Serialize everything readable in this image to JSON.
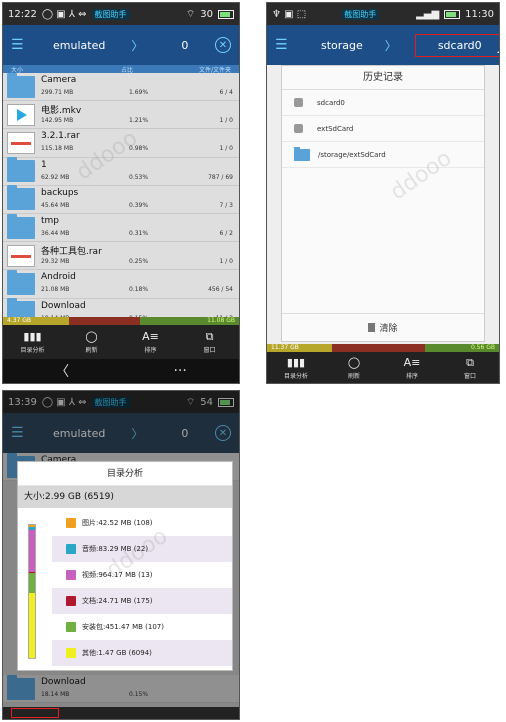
{
  "shot1": {
    "status": {
      "time": "12:22",
      "center": "截图助手",
      "battery": "30"
    },
    "appbar": {
      "path": "emulated",
      "sep": "〉",
      "count": "0"
    },
    "columns": [
      "大小",
      "占比",
      "文件/文件夹"
    ],
    "files": [
      {
        "name": "Camera",
        "size": "299.71 MB",
        "pct": "1.69%",
        "count": "6 / 4",
        "type": "folder"
      },
      {
        "name": "电影.mkv",
        "size": "142.95 MB",
        "pct": "1.21%",
        "count": "1 / 0",
        "type": "video"
      },
      {
        "name": "3.2.1.rar",
        "size": "115.18 MB",
        "pct": "0.98%",
        "count": "1 / 0",
        "type": "archive"
      },
      {
        "name": "1",
        "size": "62.92 MB",
        "pct": "0.53%",
        "count": "787 / 69",
        "type": "folder"
      },
      {
        "name": "backups",
        "size": "45.64 MB",
        "pct": "0.39%",
        "count": "7 / 3",
        "type": "folder"
      },
      {
        "name": "tmp",
        "size": "36.44 MB",
        "pct": "0.31%",
        "count": "6 / 2",
        "type": "folder"
      },
      {
        "name": "各种工具包.rar",
        "size": "29.32 MB",
        "pct": "0.25%",
        "count": "1 / 0",
        "type": "archive"
      },
      {
        "name": "Android",
        "size": "21.08 MB",
        "pct": "0.18%",
        "count": "456 / 54",
        "type": "folder"
      },
      {
        "name": "Download",
        "size": "18.14 MB",
        "pct": "0.15%",
        "count": "11 / 3",
        "type": "folder"
      }
    ],
    "storage": {
      "used": "4.37 GB",
      "mid": "",
      "free": "11.08 GB"
    },
    "bottom": [
      {
        "icon": "▮▮▮",
        "label": "目录分析"
      },
      {
        "icon": "◯",
        "label": "刷新"
      },
      {
        "icon": "A≡",
        "label": "排序"
      },
      {
        "icon": "⧉",
        "label": "窗口"
      }
    ],
    "nav": {
      "back": "〈",
      "more": "···"
    }
  },
  "shot2": {
    "status": {
      "time": "11:30",
      "center": "截图助手"
    },
    "appbar": {
      "path": "storage",
      "sep": "〉",
      "current": "sdcard0"
    },
    "dialog_title": "历史记录",
    "history": [
      {
        "label": "sdcard0",
        "type": "drive"
      },
      {
        "label": "extSdCard",
        "type": "drive"
      },
      {
        "label": "/storage/extSdCard",
        "type": "folder"
      }
    ],
    "clear_label": "清除",
    "storage": {
      "used": "11.37 GB",
      "mid": "",
      "free": "0.56 GB"
    },
    "bottom": [
      {
        "icon": "▮▮▮",
        "label": "目录分析"
      },
      {
        "icon": "◯",
        "label": "刷新"
      },
      {
        "icon": "A≡",
        "label": "排序"
      },
      {
        "icon": "⧉",
        "label": "窗口"
      }
    ]
  },
  "shot3": {
    "status": {
      "time": "13:39",
      "center": "截图助手",
      "battery": "54"
    },
    "appbar": {
      "path": "emulated",
      "sep": "〉",
      "count": "0"
    },
    "bg_first": "Camera",
    "bg_last": "Download",
    "bg_last_size": "18.14 MB",
    "bg_last_pct": "0.15%",
    "dialog_title": "目录分析",
    "summary": "大小:2.99 GB (6519)",
    "categories": [
      {
        "label": "图片:42.52 MB (108)",
        "color": "#f0a020",
        "fraction": 0.014
      },
      {
        "label": "音频:83.29 MB (22)",
        "color": "#2aa6c6",
        "fraction": 0.027
      },
      {
        "label": "视频:964.17 MB (13)",
        "color": "#c860c0",
        "fraction": 0.315
      },
      {
        "label": "文档:24.71 MB (175)",
        "color": "#b01830",
        "fraction": 0.008
      },
      {
        "label": "安装包:451.47 MB (107)",
        "color": "#70b040",
        "fraction": 0.147
      },
      {
        "label": "其他:1.47 GB (6094)",
        "color": "#f0f020",
        "fraction": 0.489
      }
    ]
  }
}
